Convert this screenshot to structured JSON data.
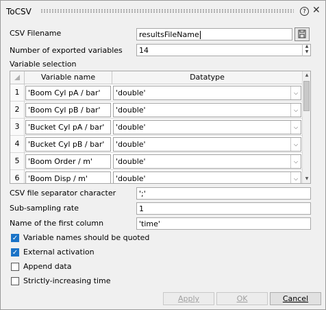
{
  "window": {
    "title": "ToCSV",
    "help_glyph": "?",
    "close_glyph": "✕"
  },
  "csv_filename": {
    "label": "CSV Filename",
    "value": "resultsFileName"
  },
  "num_vars": {
    "label": "Number of exported variables",
    "value": "14"
  },
  "var_sel": {
    "label": "Variable selection"
  },
  "table": {
    "headers": [
      "Variable name",
      "Datatype"
    ],
    "rows": [
      {
        "n": "1",
        "name": "'Boom Cyl pA / bar'",
        "type": "'double'"
      },
      {
        "n": "2",
        "name": "'Boom Cyl pB / bar'",
        "type": "'double'"
      },
      {
        "n": "3",
        "name": "'Bucket Cyl pA / bar'",
        "type": "'double'"
      },
      {
        "n": "4",
        "name": "'Bucket Cyl pB / bar'",
        "type": "'double'"
      },
      {
        "n": "5",
        "name": "'Boom Order / m'",
        "type": "'double'"
      },
      {
        "n": "6",
        "name": "'Boom Disp / m'",
        "type": "'double'"
      }
    ]
  },
  "separator": {
    "label": "CSV file separator character",
    "value": "';'"
  },
  "subsampling": {
    "label": "Sub-sampling rate",
    "value": "1"
  },
  "firstcol": {
    "label": "Name of the first column",
    "value": "'time'"
  },
  "checks": [
    {
      "label": "Variable names should be quoted",
      "checked": true
    },
    {
      "label": "External activation",
      "checked": true
    },
    {
      "label": "Append data",
      "checked": false
    },
    {
      "label": "Strictly-increasing time",
      "checked": false
    }
  ],
  "buttons": {
    "apply": "Apply",
    "ok": "OK",
    "cancel": "Cancel"
  },
  "colors": {
    "accent": "#1a73c7"
  }
}
